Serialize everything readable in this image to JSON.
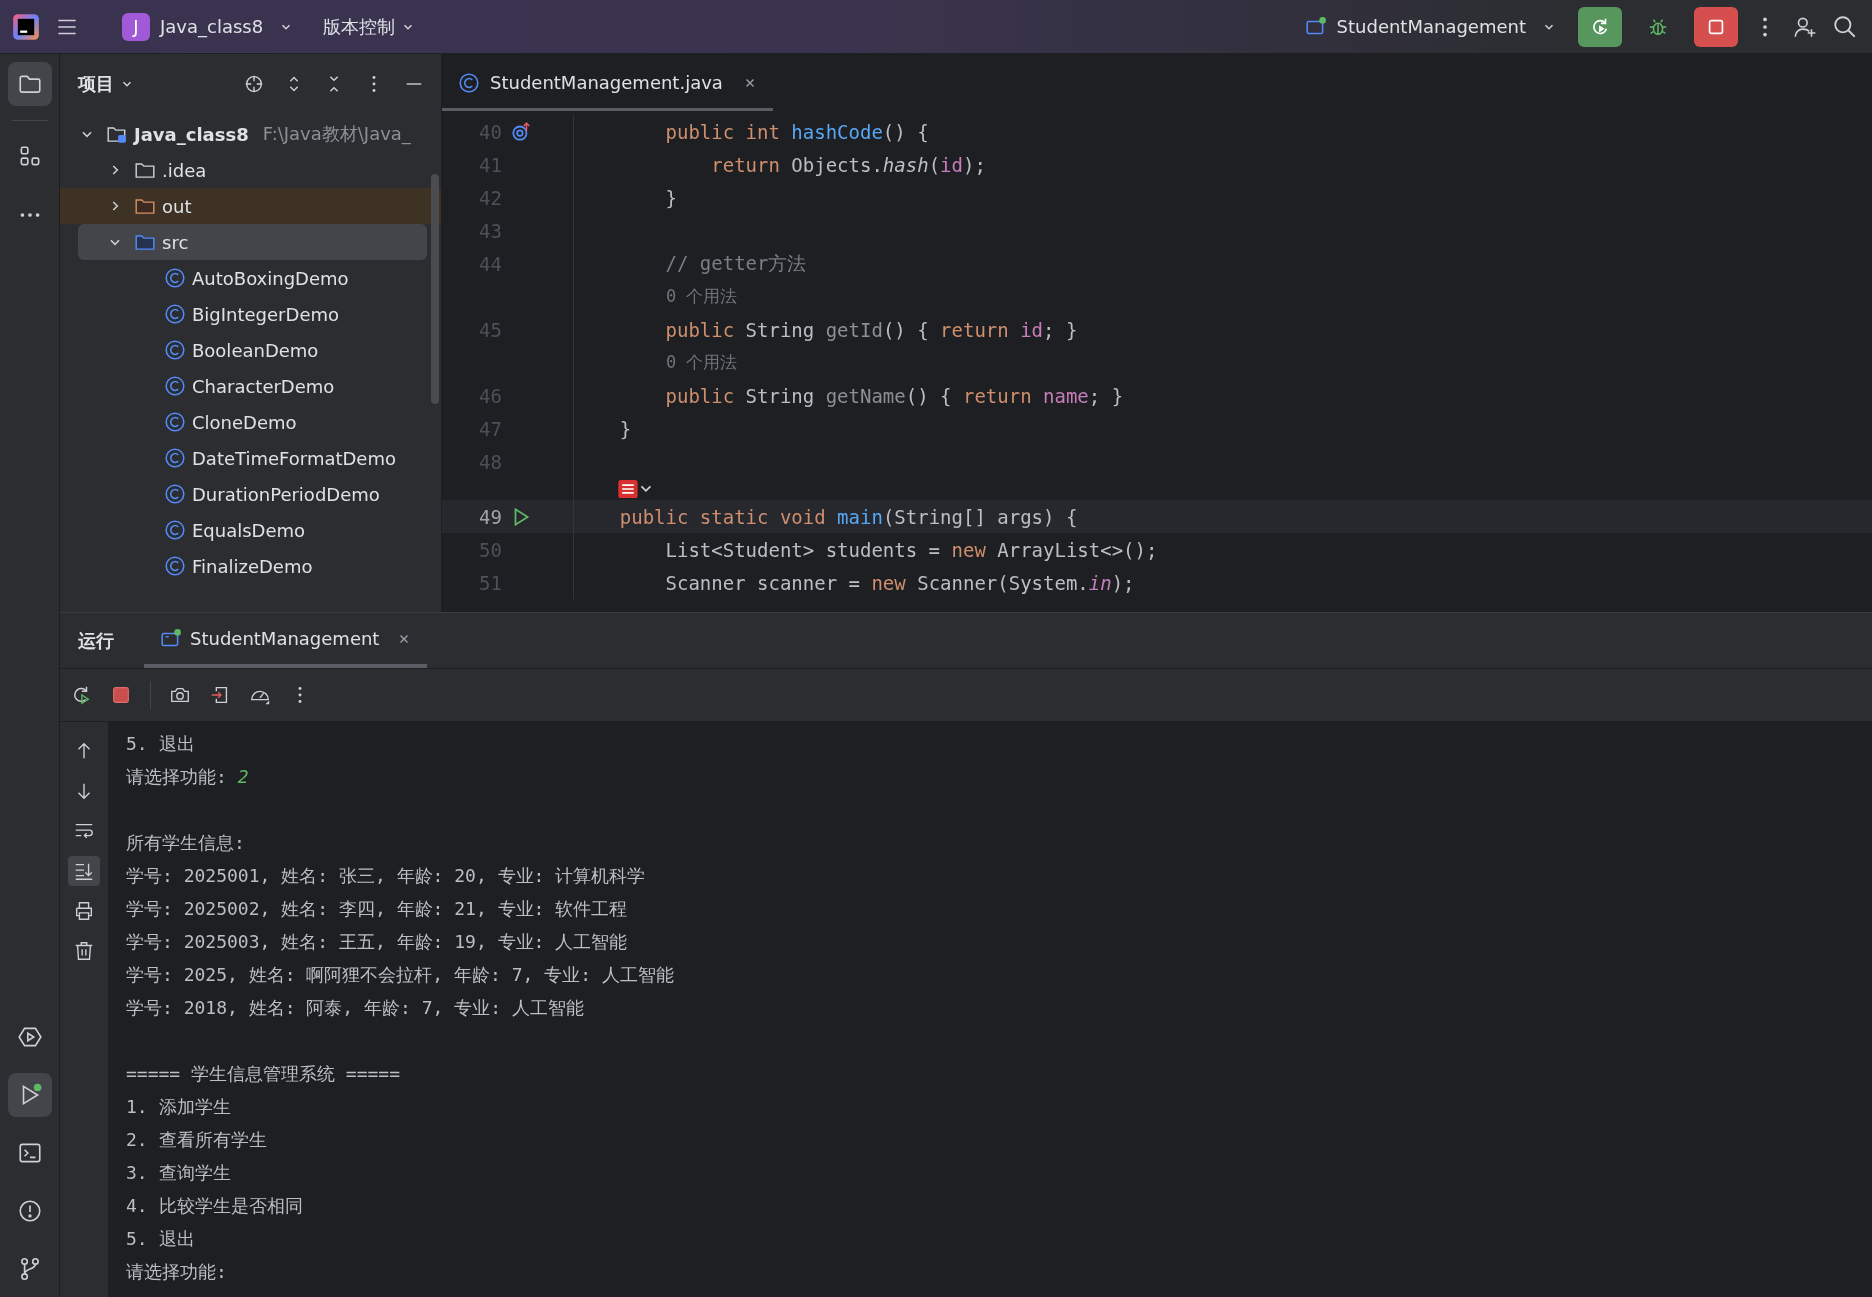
{
  "title_bar": {
    "project_badge": "J",
    "project_name": "Java_class8",
    "vcs_menu": "版本控制",
    "run_config": "StudentManagement"
  },
  "tool_strip_top": [
    {
      "kind": "project",
      "selected": true
    },
    {
      "kind": "structure",
      "selected": false
    },
    {
      "kind": "more",
      "selected": false
    }
  ],
  "tool_strip_bottom": [
    {
      "kind": "services",
      "selected": false
    },
    {
      "kind": "run",
      "selected": true
    },
    {
      "kind": "terminal",
      "selected": false
    },
    {
      "kind": "problems",
      "selected": false
    },
    {
      "kind": "git",
      "selected": false
    }
  ],
  "project_panel": {
    "title": "项目",
    "tree": [
      {
        "kind": "module",
        "label": "Java_class8",
        "path": "F:\\Java教材\\Java_",
        "expanded": true,
        "selected": false,
        "excluded": false,
        "children": [
          {
            "kind": "folder",
            "label": ".idea",
            "expanded": false,
            "selected": false,
            "excluded": false
          },
          {
            "kind": "folder",
            "label": "out",
            "expanded": false,
            "selected": false,
            "excluded": true
          },
          {
            "kind": "source",
            "label": "src",
            "expanded": true,
            "selected": true,
            "excluded": false,
            "children": [
              {
                "kind": "class",
                "label": "AutoBoxingDemo",
                "selected": false,
                "excluded": false
              },
              {
                "kind": "class",
                "label": "BigIntegerDemo",
                "selected": false,
                "excluded": false
              },
              {
                "kind": "class",
                "label": "BooleanDemo",
                "selected": false,
                "excluded": false
              },
              {
                "kind": "class",
                "label": "CharacterDemo",
                "selected": false,
                "excluded": false
              },
              {
                "kind": "class",
                "label": "CloneDemo",
                "selected": false,
                "excluded": false
              },
              {
                "kind": "class",
                "label": "DateTimeFormatDemo",
                "selected": false,
                "excluded": false
              },
              {
                "kind": "class",
                "label": "DurationPeriodDemo",
                "selected": false,
                "excluded": false
              },
              {
                "kind": "class",
                "label": "EqualsDemo",
                "selected": false,
                "excluded": false
              },
              {
                "kind": "class",
                "label": "FinalizeDemo",
                "selected": false,
                "excluded": false
              }
            ]
          }
        ]
      }
    ]
  },
  "editor": {
    "tabs": [
      {
        "label": "StudentManagement.java",
        "selected": true
      }
    ],
    "lines": [
      {
        "kind": "code",
        "number": "40",
        "gutter": {
          "kind": "override"
        },
        "current": false,
        "tokens": [
          {
            "kind": "kw",
            "t": "        public int "
          },
          {
            "kind": "fn",
            "t": "hashCode"
          },
          {
            "kind": "plain",
            "t": "() {"
          }
        ]
      },
      {
        "kind": "code",
        "number": "41",
        "current": false,
        "tokens": [
          {
            "kind": "kw",
            "t": "            return "
          },
          {
            "kind": "plain",
            "t": "Objects."
          },
          {
            "kind": "static",
            "t": "hash"
          },
          {
            "kind": "plain",
            "t": "("
          },
          {
            "kind": "field",
            "t": "id"
          },
          {
            "kind": "plain",
            "t": ");"
          }
        ]
      },
      {
        "kind": "code",
        "number": "42",
        "current": false,
        "tokens": [
          {
            "kind": "plain",
            "t": "        }"
          }
        ]
      },
      {
        "kind": "code",
        "number": "43",
        "current": false
      },
      {
        "kind": "code",
        "number": "44",
        "current": false,
        "tokens": [
          {
            "kind": "comment",
            "t": "        // getter方法"
          }
        ]
      },
      {
        "kind": "hint",
        "text": "0 个用法"
      },
      {
        "kind": "code",
        "number": "45",
        "current": false,
        "tokens": [
          {
            "kind": "kw",
            "t": "        public "
          },
          {
            "kind": "plain",
            "t": "String "
          },
          {
            "kind": "unused",
            "t": "getId"
          },
          {
            "kind": "plain",
            "t": "() { "
          },
          {
            "kind": "kw",
            "t": "return "
          },
          {
            "kind": "field",
            "t": "id"
          },
          {
            "kind": "plain",
            "t": "; }"
          }
        ]
      },
      {
        "kind": "hint",
        "text": "0 个用法"
      },
      {
        "kind": "code",
        "number": "46",
        "current": false,
        "tokens": [
          {
            "kind": "kw",
            "t": "        public "
          },
          {
            "kind": "plain",
            "t": "String "
          },
          {
            "kind": "unused",
            "t": "getName"
          },
          {
            "kind": "plain",
            "t": "() { "
          },
          {
            "kind": "kw",
            "t": "return "
          },
          {
            "kind": "field",
            "t": "name"
          },
          {
            "kind": "plain",
            "t": "; }"
          }
        ]
      },
      {
        "kind": "code",
        "number": "47",
        "current": false,
        "tokens": [
          {
            "kind": "plain",
            "t": "    }"
          }
        ]
      },
      {
        "kind": "code",
        "number": "48",
        "current": false
      },
      {
        "kind": "inlay"
      },
      {
        "kind": "code",
        "number": "49",
        "gutter": {
          "kind": "run"
        },
        "current": true,
        "tokens": [
          {
            "kind": "kw",
            "t": "    public static void "
          },
          {
            "kind": "fn",
            "t": "main"
          },
          {
            "kind": "plain",
            "t": "(String[] args) {"
          }
        ]
      },
      {
        "kind": "code",
        "number": "50",
        "current": false,
        "tokens": [
          {
            "kind": "plain",
            "t": "        List<Student> students = "
          },
          {
            "kind": "kw",
            "t": "new "
          },
          {
            "kind": "plain",
            "t": "ArrayList<>();"
          }
        ]
      },
      {
        "kind": "code",
        "number": "51",
        "current": false,
        "tokens": [
          {
            "kind": "plain",
            "t": "        Scanner scanner = "
          },
          {
            "kind": "kw",
            "t": "new "
          },
          {
            "kind": "plain",
            "t": "Scanner(System."
          },
          {
            "kind": "staticfield",
            "t": "in"
          },
          {
            "kind": "plain",
            "t": ");"
          }
        ]
      }
    ]
  },
  "run_panel": {
    "title": "运行",
    "tabs": [
      {
        "label": "StudentManagement",
        "selected": true
      }
    ],
    "gutter": [
      {
        "kind": "up",
        "selected": false
      },
      {
        "kind": "down",
        "selected": false
      },
      {
        "kind": "wrap",
        "selected": false
      },
      {
        "kind": "scroll-end",
        "selected": true
      },
      {
        "kind": "print",
        "selected": false
      },
      {
        "kind": "trash",
        "selected": false
      }
    ],
    "console": [
      {
        "kind": "out",
        "text": "5. 退出"
      },
      {
        "kind": "out",
        "text": "请选择功能: ",
        "input": "2"
      },
      {
        "kind": "blank"
      },
      {
        "kind": "out",
        "text": "所有学生信息:"
      },
      {
        "kind": "out",
        "text": "学号: 2025001, 姓名: 张三, 年龄: 20, 专业: 计算机科学"
      },
      {
        "kind": "out",
        "text": "学号: 2025002, 姓名: 李四, 年龄: 21, 专业: 软件工程"
      },
      {
        "kind": "out",
        "text": "学号: 2025003, 姓名: 王五, 年龄: 19, 专业: 人工智能"
      },
      {
        "kind": "out",
        "text": "学号: 2025, 姓名: 啊阿狸不会拉杆, 年龄: 7, 专业: 人工智能"
      },
      {
        "kind": "out",
        "text": "学号: 2018, 姓名: 阿泰, 年龄: 7, 专业: 人工智能"
      },
      {
        "kind": "blank"
      },
      {
        "kind": "out",
        "text": "===== 学生信息管理系统 ====="
      },
      {
        "kind": "out",
        "text": "1. 添加学生"
      },
      {
        "kind": "out",
        "text": "2. 查看所有学生"
      },
      {
        "kind": "out",
        "text": "3. 查询学生"
      },
      {
        "kind": "out",
        "text": "4. 比较学生是否相同"
      },
      {
        "kind": "out",
        "text": "5. 退出"
      },
      {
        "kind": "out",
        "text": "请选择功能:"
      }
    ]
  }
}
